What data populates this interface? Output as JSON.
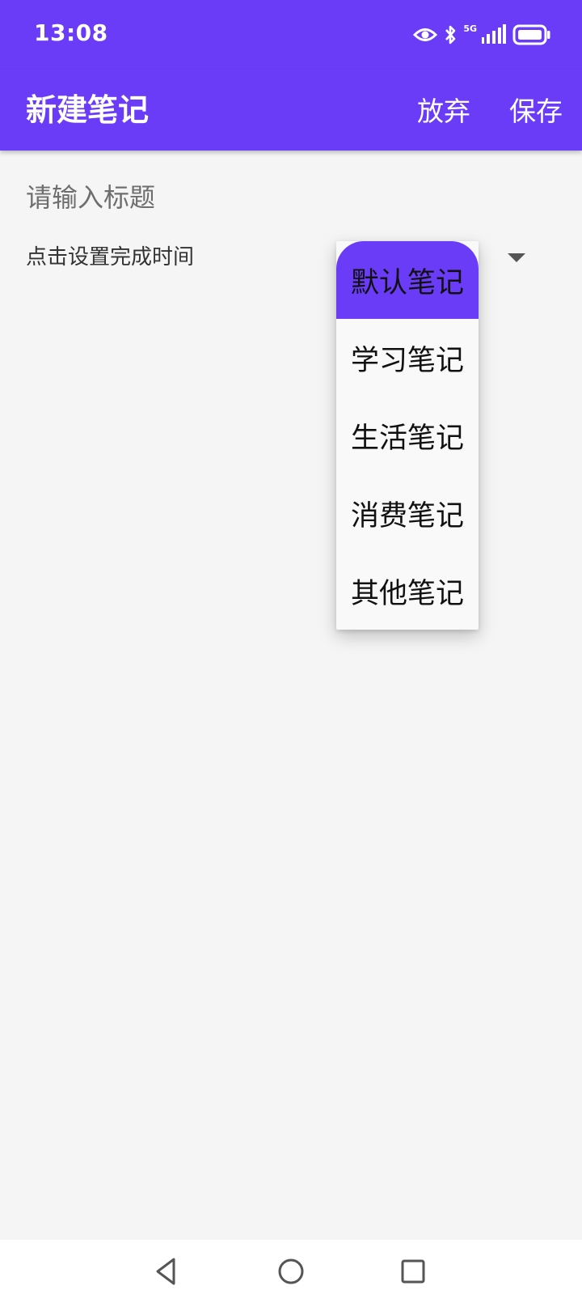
{
  "status_bar": {
    "time": "13:08",
    "network": "5G",
    "icons": [
      "eye-icon",
      "bluetooth-icon",
      "signal-icon",
      "battery-icon"
    ]
  },
  "app_bar": {
    "title": "新建笔记",
    "discard_label": "放弃",
    "save_label": "保存"
  },
  "form": {
    "title_placeholder": "请输入标题",
    "title_value": "",
    "time_setter_label": "点击设置完成时间"
  },
  "category_dropdown": {
    "selected_index": 0,
    "options": [
      "默认笔记",
      "学习笔记",
      "生活笔记",
      "消费笔记",
      "其他笔记"
    ]
  },
  "nav_bar": {
    "icons": [
      "back-icon",
      "home-icon",
      "recents-icon"
    ]
  },
  "colors": {
    "primary": "#6a3cf8",
    "background": "#f5f5f5",
    "popup": "#f9f9f9"
  }
}
